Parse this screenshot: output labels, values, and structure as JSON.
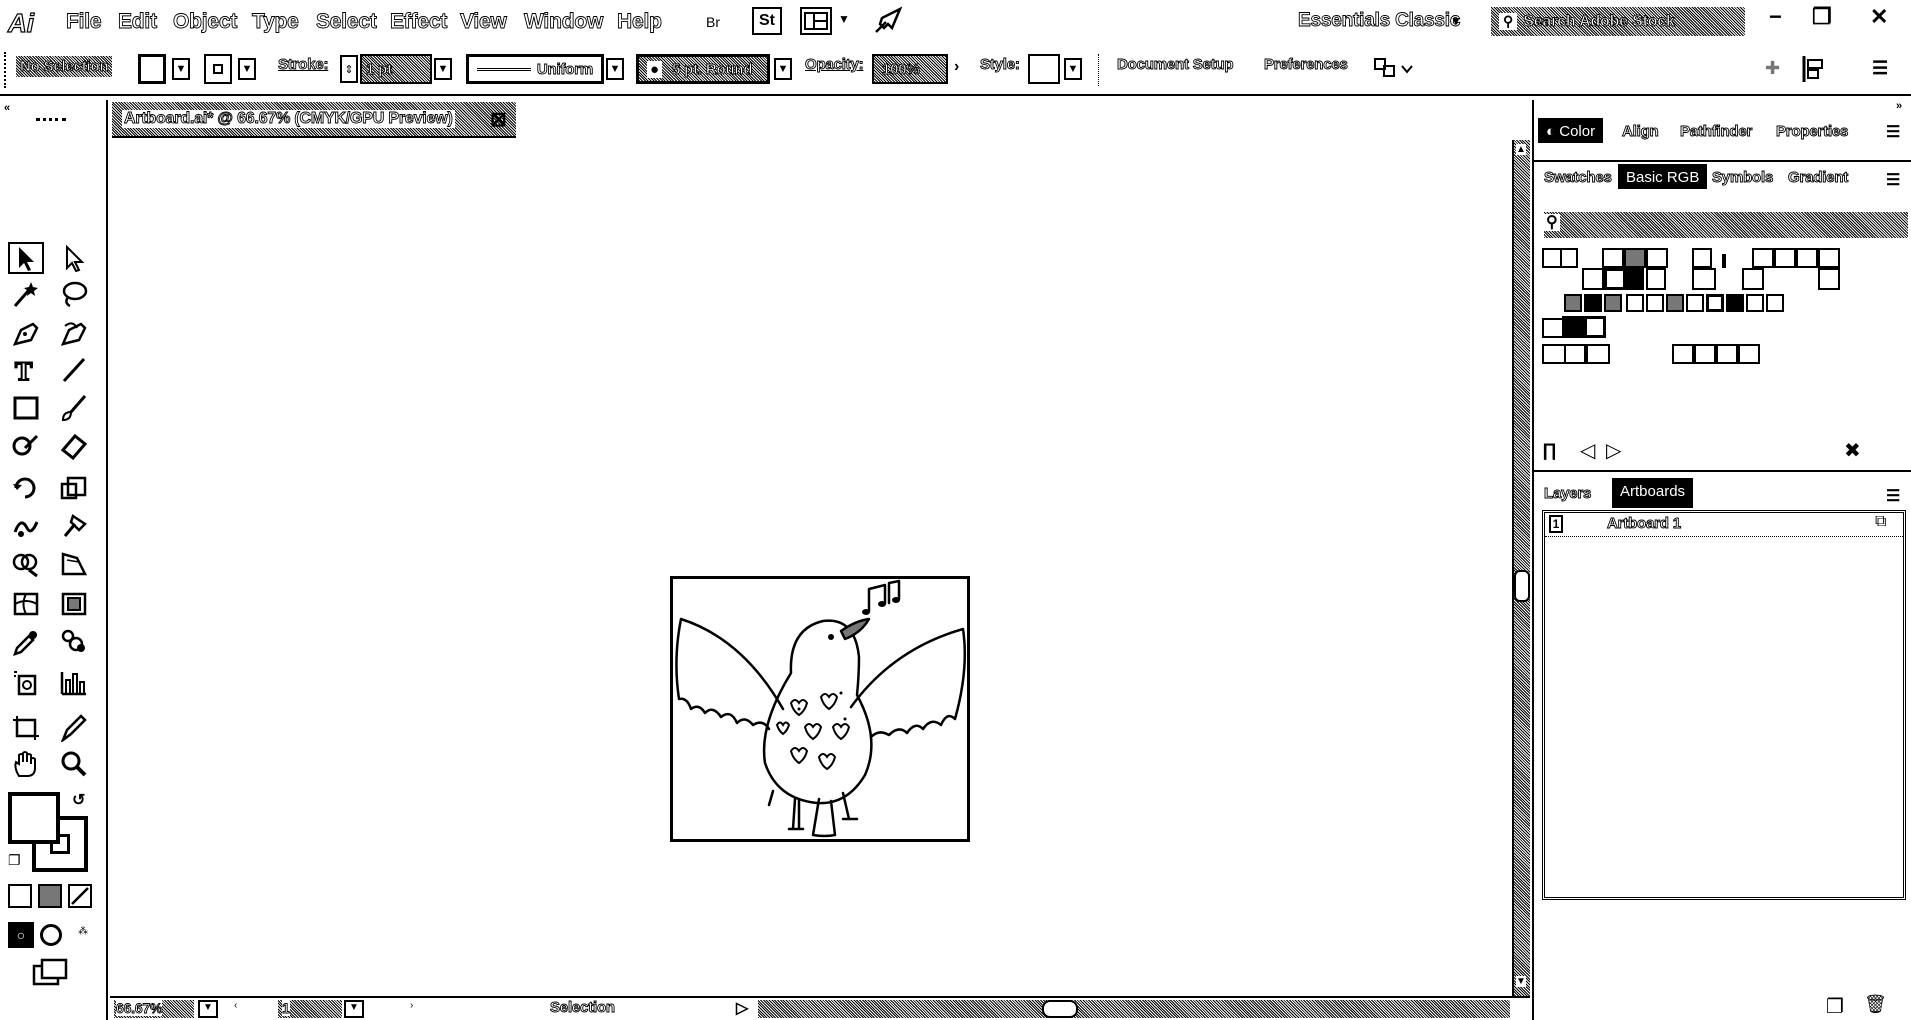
{
  "app": {
    "logo": "Ai"
  },
  "menu": [
    "File",
    "Edit",
    "Object",
    "Type",
    "Select",
    "Effect",
    "View",
    "Window",
    "Help"
  ],
  "toolbar_icons": {
    "bridge": "Br",
    "stock": "St"
  },
  "workspace": {
    "label": "Essentials Classic"
  },
  "search": {
    "placeholder": "Search Adobe Stock"
  },
  "control": {
    "selection": "No Selection",
    "stroke_label": "Stroke:",
    "stroke_weight": "1 pt",
    "profile": "Uniform",
    "brush": "5 pt. Round",
    "opacity_label": "Opacity:",
    "opacity_value": "100%",
    "style_label": "Style:",
    "document_setup": "Document Setup",
    "preferences": "Preferences"
  },
  "document": {
    "tab_title": "Artboard.ai* @ 66.67% (CMYK/GPU Preview)"
  },
  "status": {
    "zoom": "66.67%",
    "artboard_index": "1",
    "tool": "Selection"
  },
  "panel_top": {
    "tabs": [
      "Color",
      "Align",
      "Pathfinder",
      "Properties"
    ]
  },
  "panel_mid": {
    "tabs": [
      "Swatches",
      "Basic RGB",
      "Symbols",
      "Gradient"
    ]
  },
  "panel_bottom": {
    "tabs": [
      "Layers",
      "Artboards"
    ],
    "artboards": [
      {
        "num": "1",
        "name": "Artboard 1"
      }
    ]
  }
}
